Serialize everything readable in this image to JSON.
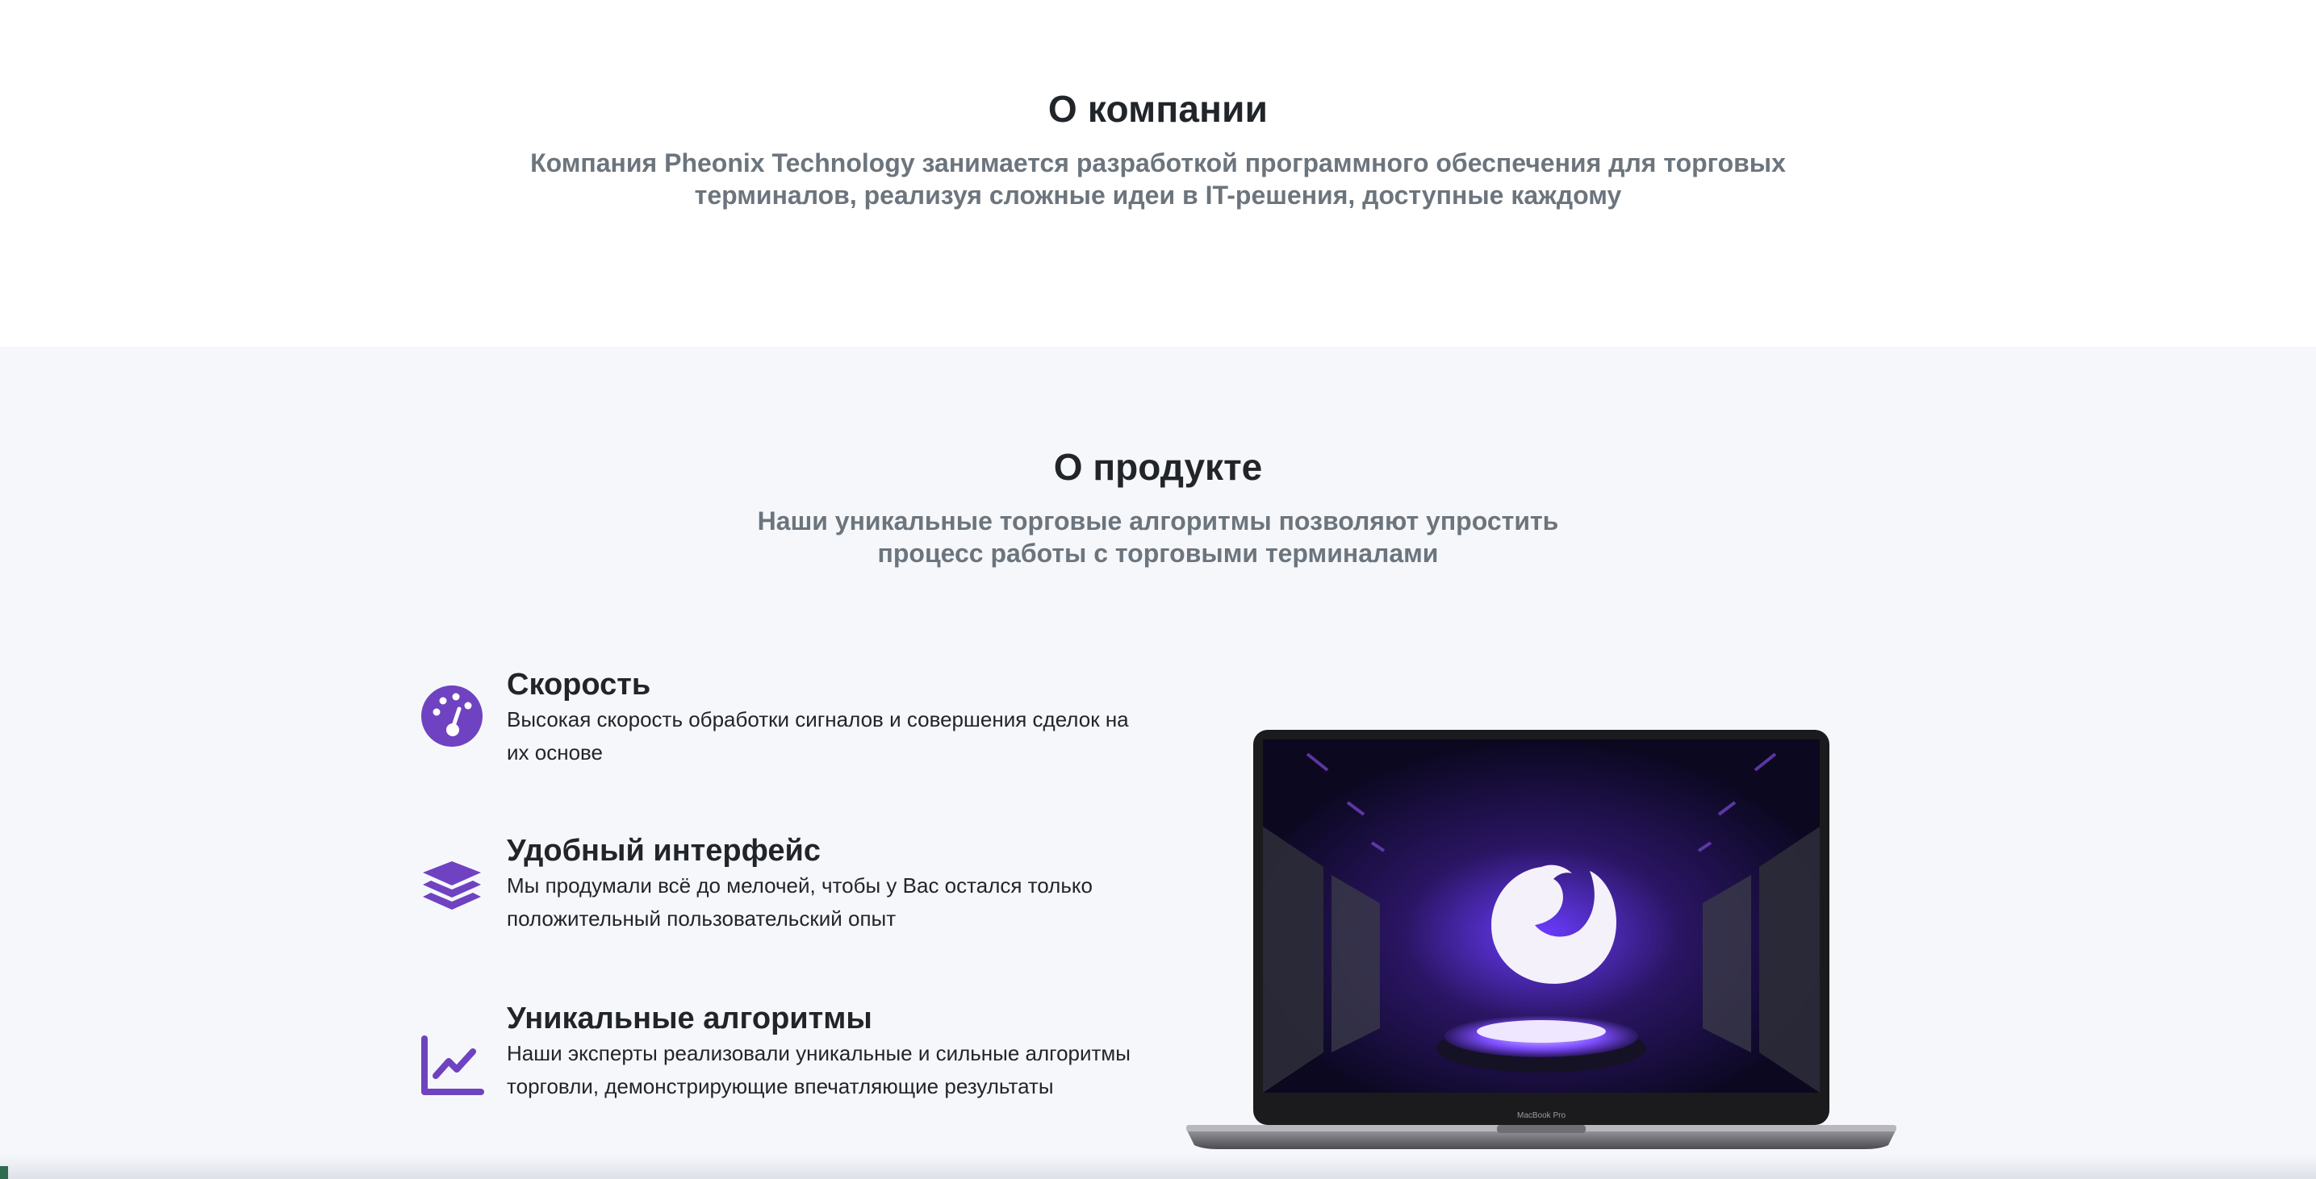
{
  "company": {
    "title": "О компании",
    "description": "Компания Pheonix Technology занимается разработкой программного обеспечения для торговых терминалов, реализуя сложные идеи в IT-решения, доступные каждому"
  },
  "product": {
    "title": "О продукте",
    "description": "Наши уникальные торговые алгоритмы позволяют упростить процесс работы с торговыми терминалами",
    "features": [
      {
        "icon": "speedometer-icon",
        "title": "Скорость",
        "text": "Высокая скорость обработки сигналов и совершения сделок на их основе"
      },
      {
        "icon": "layers-icon",
        "title": "Удобный интерфейс",
        "text": "Мы продумали всё до мелочей, чтобы у Вас остался только положительный пользовательский опыт"
      },
      {
        "icon": "line-chart-icon",
        "title": "Уникальные алгоритмы",
        "text": "Наши эксперты реализовали уникальные и сильные алгоритмы торговли, демонстрирующие впечатляющие результаты"
      }
    ],
    "laptop_label": "MacBook Pro"
  },
  "colors": {
    "accent": "#6f42c1",
    "heading": "#212529",
    "muted": "#6c757d",
    "section_bg": "#f6f7fb"
  }
}
